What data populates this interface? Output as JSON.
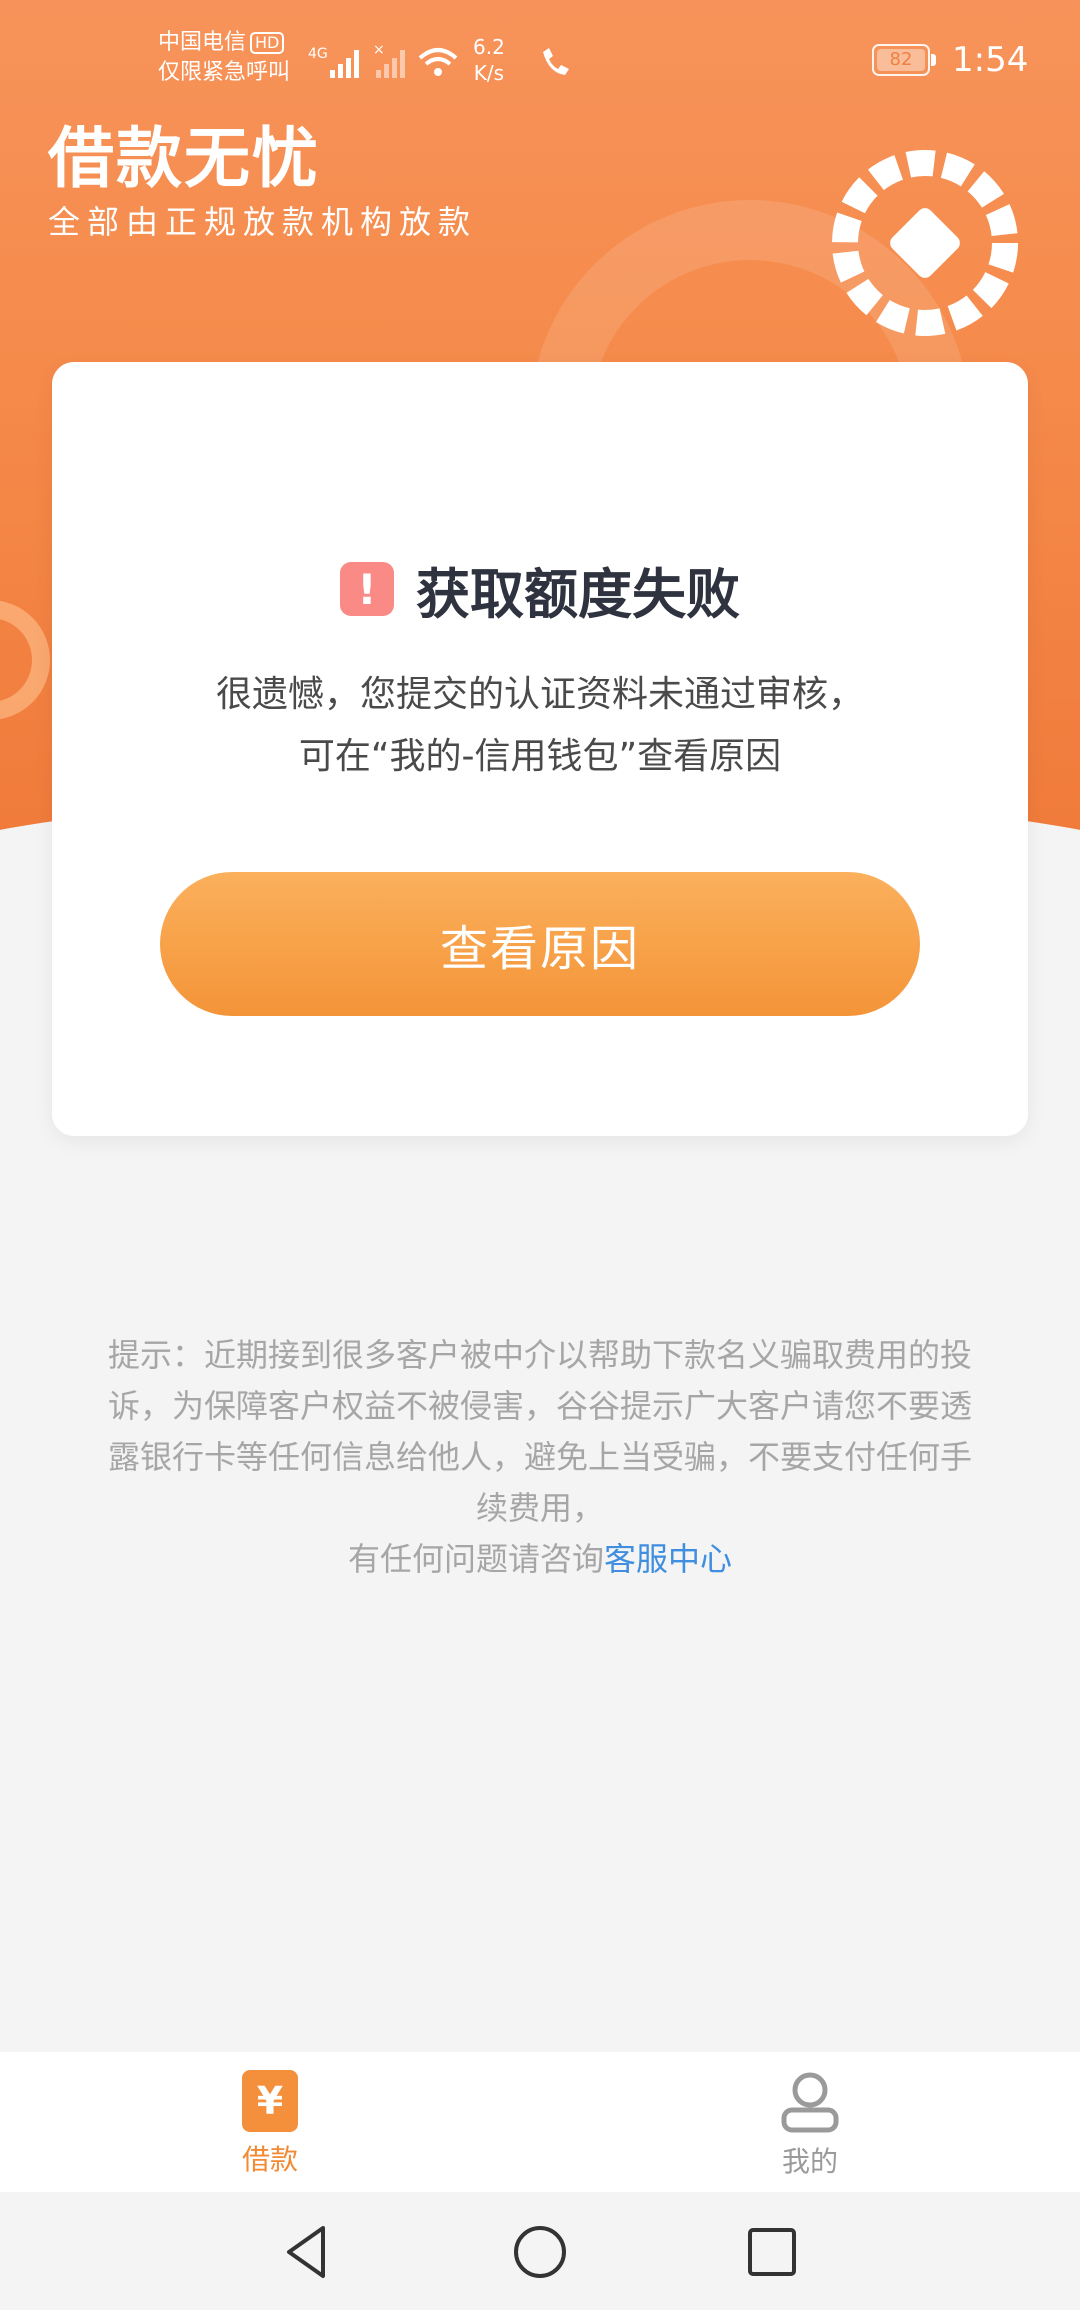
{
  "status_bar": {
    "carrier": "中国电信",
    "hd_badge": "HD",
    "emergency": "仅限紧急呼叫",
    "network_type": "4G",
    "speed_value": "6.2",
    "speed_unit": "K/s",
    "battery_level": "82",
    "time": "1:54"
  },
  "header": {
    "title": "借款无忧",
    "subtitle": "全部由正规放款机构放款"
  },
  "result_card": {
    "title": "获取额度失败",
    "message_line1": "很遗憾，您提交的认证资料未通过审核，",
    "message_line2": "可在“我的-信用钱包”查看原因",
    "button_label": "查看原因"
  },
  "notice": {
    "text": "提示：近期接到很多客户被中介以帮助下款名义骗取费用的投诉，为保障客户权益不被侵害，谷谷提示广大客户请您不要透露银行卡等任何信息给他人，避免上当受骗，不要支付任何手续费用，",
    "contact_prefix": "有任何问题请咨询",
    "contact_link": "客服中心"
  },
  "tab_bar": {
    "loan_icon_glyph": "¥",
    "loan_label": "借款",
    "mine_label": "我的"
  },
  "colors": {
    "brand_orange": "#f58a4a",
    "button_orange": "#f49438",
    "link_blue": "#3f8ee0",
    "warning_red": "#f98a86"
  },
  "icons": {
    "warning": "exclamation-icon",
    "loan_tab": "yen-icon",
    "mine_tab": "user-icon",
    "nav_back": "triangle-back-icon",
    "nav_home": "circle-home-icon",
    "nav_recent": "square-recent-icon"
  }
}
